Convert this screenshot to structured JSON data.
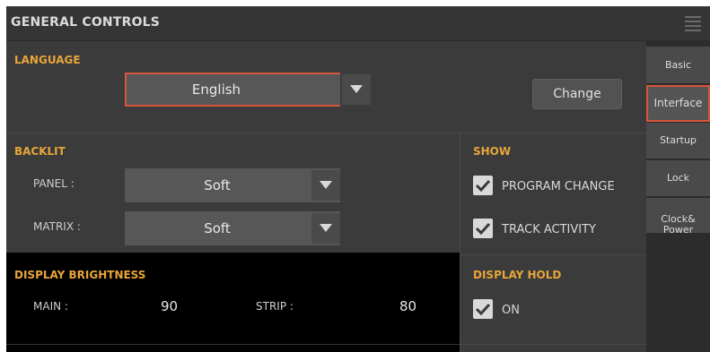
{
  "header": {
    "title": "GENERAL CONTROLS",
    "menu_icon": "hamburger-icon"
  },
  "language": {
    "section_title": "LANGUAGE",
    "selected": "English",
    "change_button": "Change"
  },
  "backlit": {
    "section_title": "BACKLIT",
    "panel_label": "PANEL :",
    "panel_value": "Soft",
    "matrix_label": "MATRIX :",
    "matrix_value": "Soft"
  },
  "show": {
    "section_title": "SHOW",
    "program_change": {
      "label": "PROGRAM CHANGE",
      "checked": true
    },
    "track_activity": {
      "label": "TRACK ACTIVITY",
      "checked": true
    }
  },
  "display_brightness": {
    "section_title": "DISPLAY BRIGHTNESS",
    "main_label": "MAIN :",
    "main_value": "90",
    "strip_label": "STRIP :",
    "strip_value": "80"
  },
  "display_hold": {
    "section_title": "DISPLAY HOLD",
    "on": {
      "label": "ON",
      "checked": true
    }
  },
  "tabs": [
    {
      "label": "Basic",
      "active": false
    },
    {
      "label": "Interface",
      "active": true
    },
    {
      "label": "Startup",
      "active": false
    },
    {
      "label": "Lock",
      "active": false
    },
    {
      "label": "Clock&\nPower",
      "active": false
    }
  ],
  "colors": {
    "accent": "#e8a53a",
    "selection": "#d9553b",
    "background": "#3b3b3b"
  }
}
